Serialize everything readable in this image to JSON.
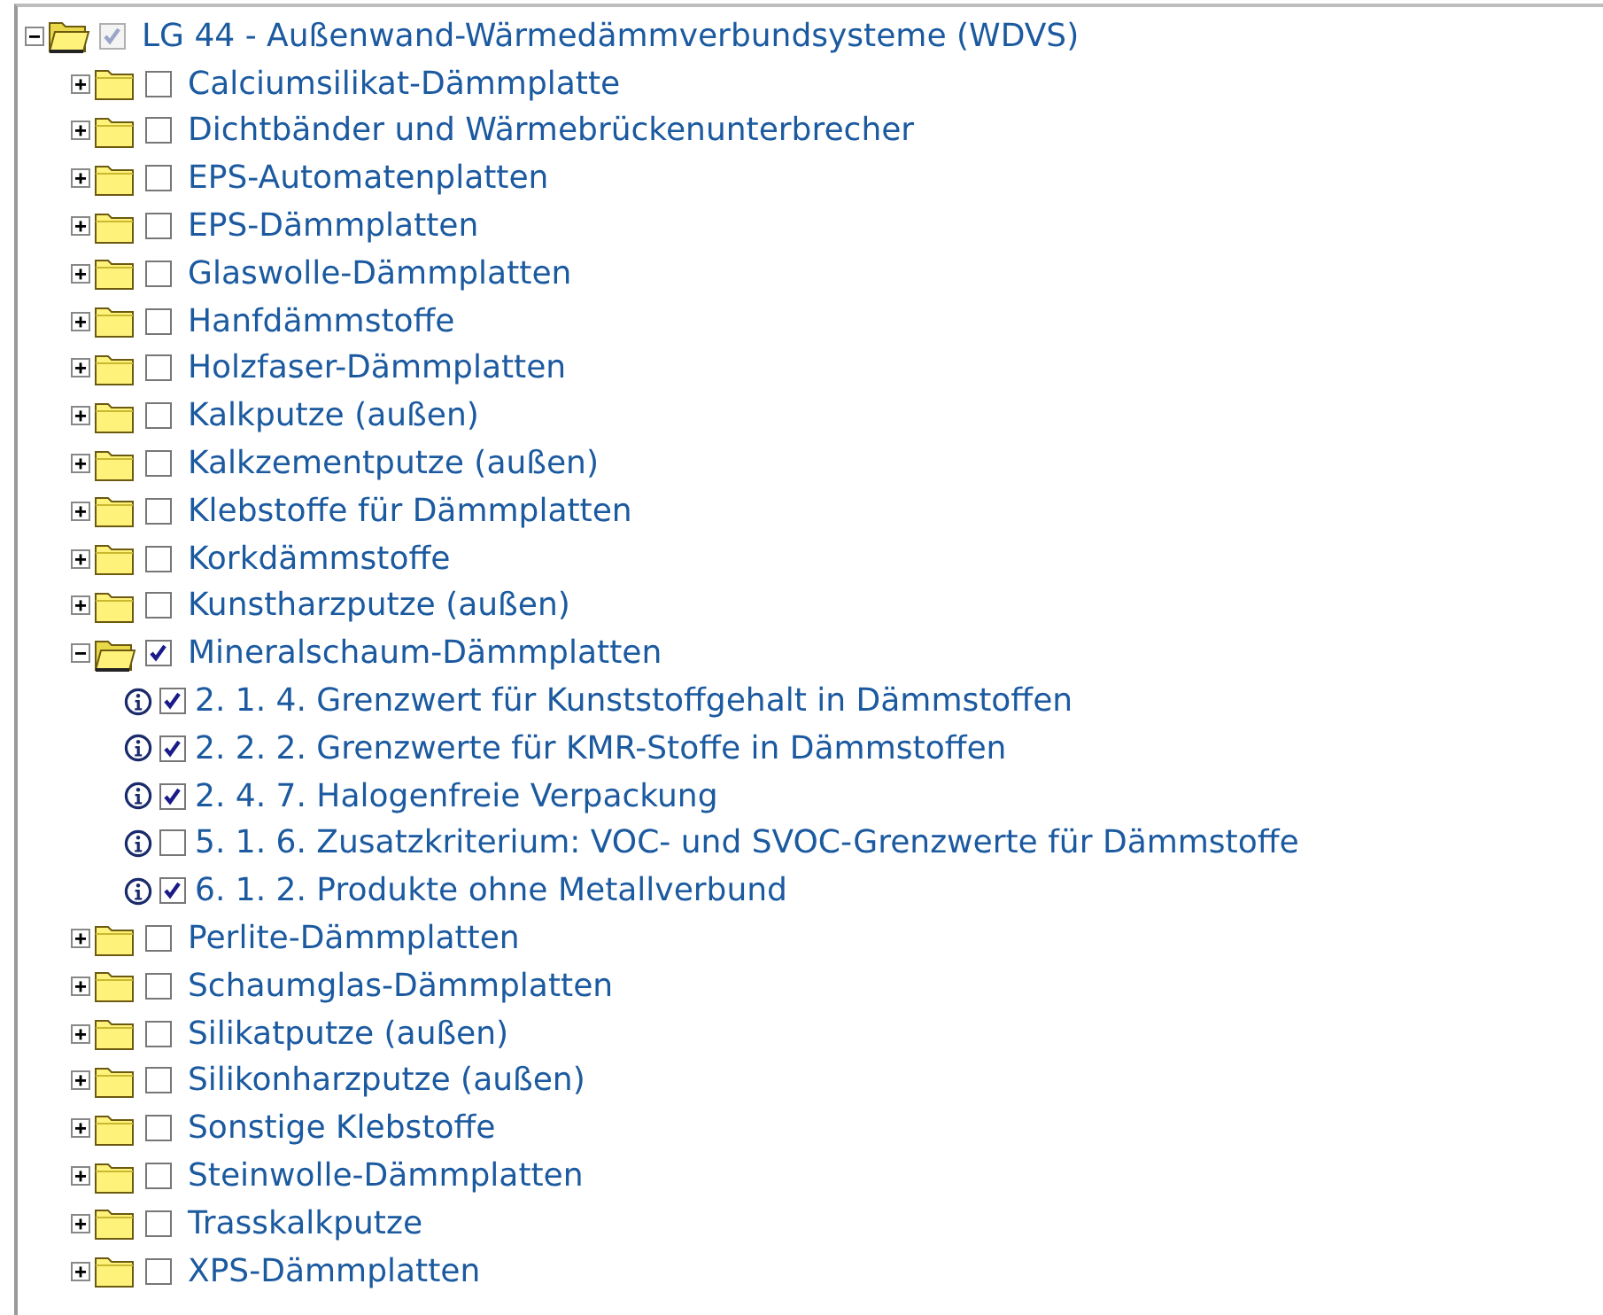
{
  "tree": {
    "kind": "group",
    "label": "LG 44 - Außenwand-Wärmedämmverbundsysteme (WDVS)",
    "expanded": true,
    "checked": true,
    "disabled": true,
    "children": [
      {
        "kind": "group",
        "label": "Calciumsilikat-Dämmplatte",
        "expanded": false,
        "checked": false
      },
      {
        "kind": "group",
        "label": "Dichtbänder und Wärmebrückenunterbrecher",
        "expanded": false,
        "checked": false
      },
      {
        "kind": "group",
        "label": "EPS-Automatenplatten",
        "expanded": false,
        "checked": false
      },
      {
        "kind": "group",
        "label": "EPS-Dämmplatten",
        "expanded": false,
        "checked": false
      },
      {
        "kind": "group",
        "label": "Glaswolle-Dämmplatten",
        "expanded": false,
        "checked": false
      },
      {
        "kind": "group",
        "label": "Hanfdämmstoffe",
        "expanded": false,
        "checked": false
      },
      {
        "kind": "group",
        "label": "Holzfaser-Dämmplatten",
        "expanded": false,
        "checked": false
      },
      {
        "kind": "group",
        "label": "Kalkputze (außen)",
        "expanded": false,
        "checked": false
      },
      {
        "kind": "group",
        "label": "Kalkzementputze (außen)",
        "expanded": false,
        "checked": false
      },
      {
        "kind": "group",
        "label": "Klebstoffe für Dämmplatten",
        "expanded": false,
        "checked": false
      },
      {
        "kind": "group",
        "label": "Korkdämmstoffe",
        "expanded": false,
        "checked": false
      },
      {
        "kind": "group",
        "label": "Kunstharzputze (außen)",
        "expanded": false,
        "checked": false
      },
      {
        "kind": "group",
        "label": "Mineralschaum-Dämmplatten",
        "expanded": true,
        "checked": true,
        "children": [
          {
            "kind": "criterion",
            "label": "2. 1. 4. Grenzwert für Kunststoffgehalt in Dämmstoffen",
            "checked": true
          },
          {
            "kind": "criterion",
            "label": "2. 2. 2. Grenzwerte für KMR-Stoffe in Dämmstoffen",
            "checked": true
          },
          {
            "kind": "criterion",
            "label": "2. 4. 7. Halogenfreie Verpackung",
            "checked": true
          },
          {
            "kind": "criterion",
            "label": "5. 1. 6. Zusatzkriterium: VOC- und SVOC-Grenzwerte für Dämmstoffe",
            "checked": false
          },
          {
            "kind": "criterion",
            "label": "6. 1. 2. Produkte ohne Metallverbund",
            "checked": true
          }
        ]
      },
      {
        "kind": "group",
        "label": "Perlite-Dämmplatten",
        "expanded": false,
        "checked": false
      },
      {
        "kind": "group",
        "label": "Schaumglas-Dämmplatten",
        "expanded": false,
        "checked": false
      },
      {
        "kind": "group",
        "label": "Silikatputze (außen)",
        "expanded": false,
        "checked": false
      },
      {
        "kind": "group",
        "label": "Silikonharzputze (außen)",
        "expanded": false,
        "checked": false
      },
      {
        "kind": "group",
        "label": "Sonstige Klebstoffe",
        "expanded": false,
        "checked": false
      },
      {
        "kind": "group",
        "label": "Steinwolle-Dämmplatten",
        "expanded": false,
        "checked": false
      },
      {
        "kind": "group",
        "label": "Trasskalkputze",
        "expanded": false,
        "checked": false
      },
      {
        "kind": "group",
        "label": "XPS-Dämmplatten",
        "expanded": false,
        "checked": false
      }
    ]
  }
}
